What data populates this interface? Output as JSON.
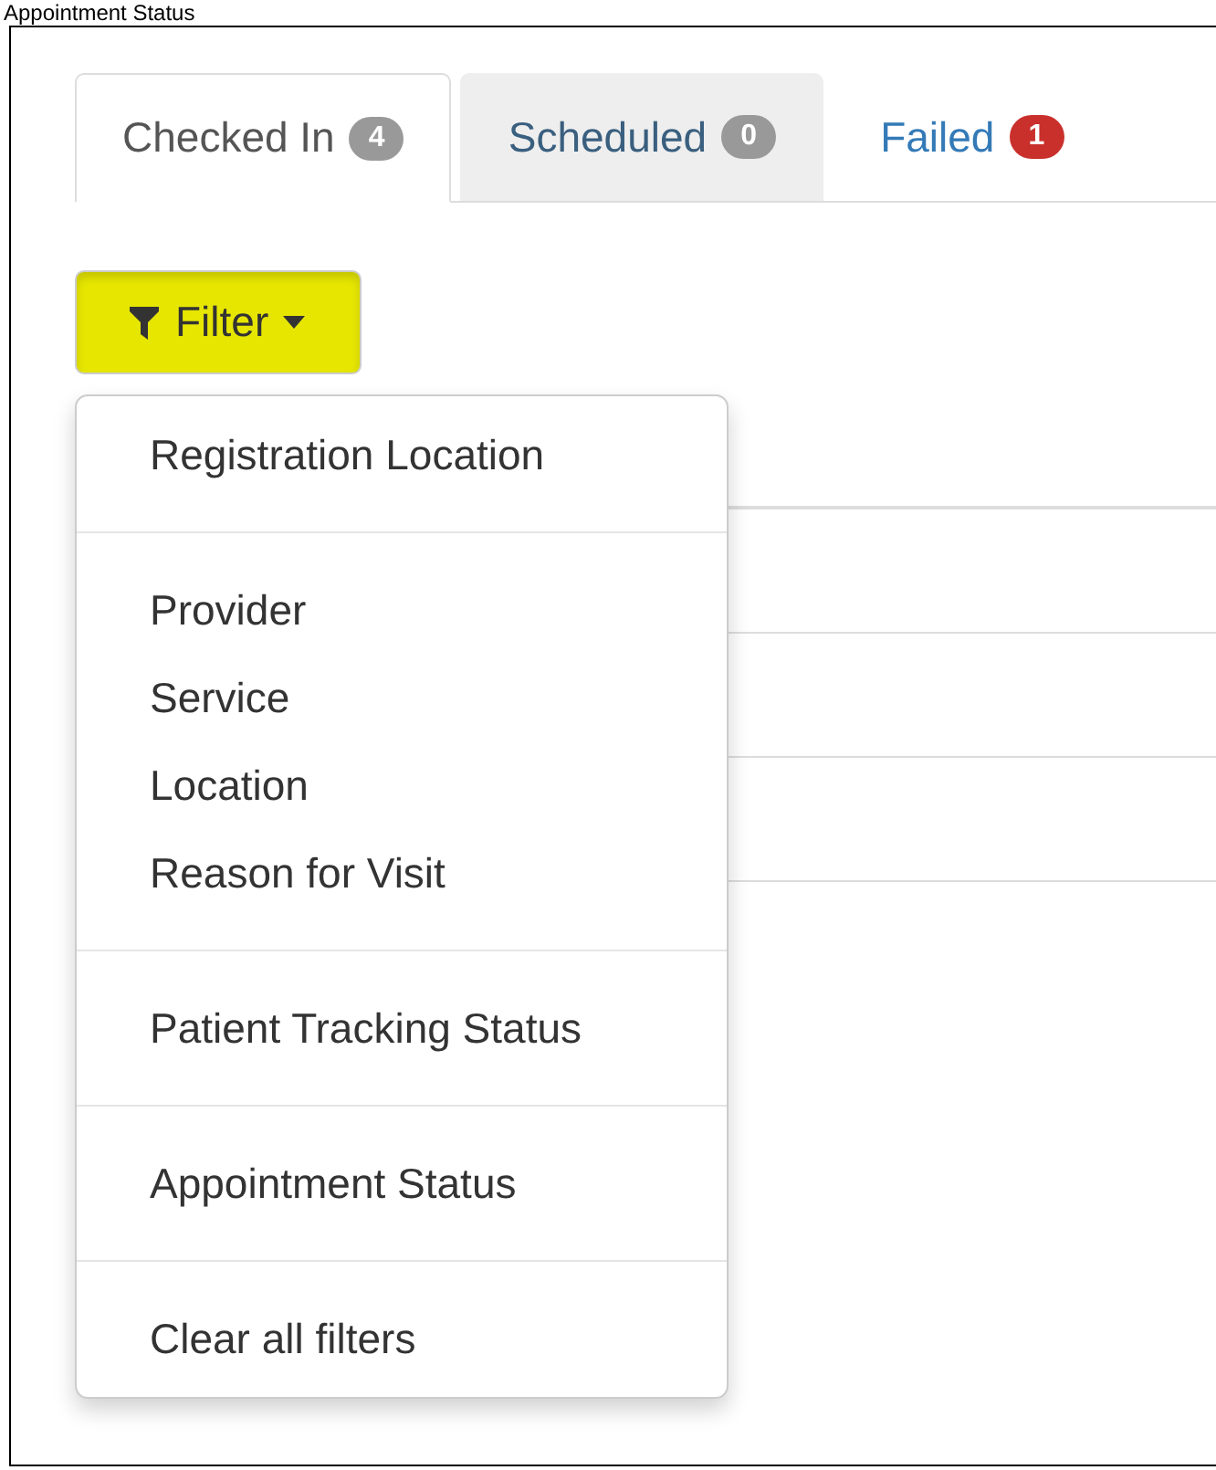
{
  "caption": "Appointment Status",
  "tabs": [
    {
      "label": "Checked In",
      "count": "4",
      "color": "#999999",
      "selected": true
    },
    {
      "label": "Scheduled",
      "count": "0",
      "color": "#999999",
      "selected": false
    },
    {
      "label": "Failed",
      "count": "1",
      "color": "#c9302c",
      "selected": false
    }
  ],
  "filter_button": {
    "label": "Filter",
    "highlighted": true
  },
  "filter_menu": {
    "groups": [
      [
        "Registration Location"
      ],
      [
        "Provider",
        "Service",
        "Location",
        "Reason for Visit"
      ],
      [
        "Patient Tracking Status"
      ],
      [
        "Appointment Status"
      ],
      [
        "Clear all filters"
      ]
    ]
  }
}
